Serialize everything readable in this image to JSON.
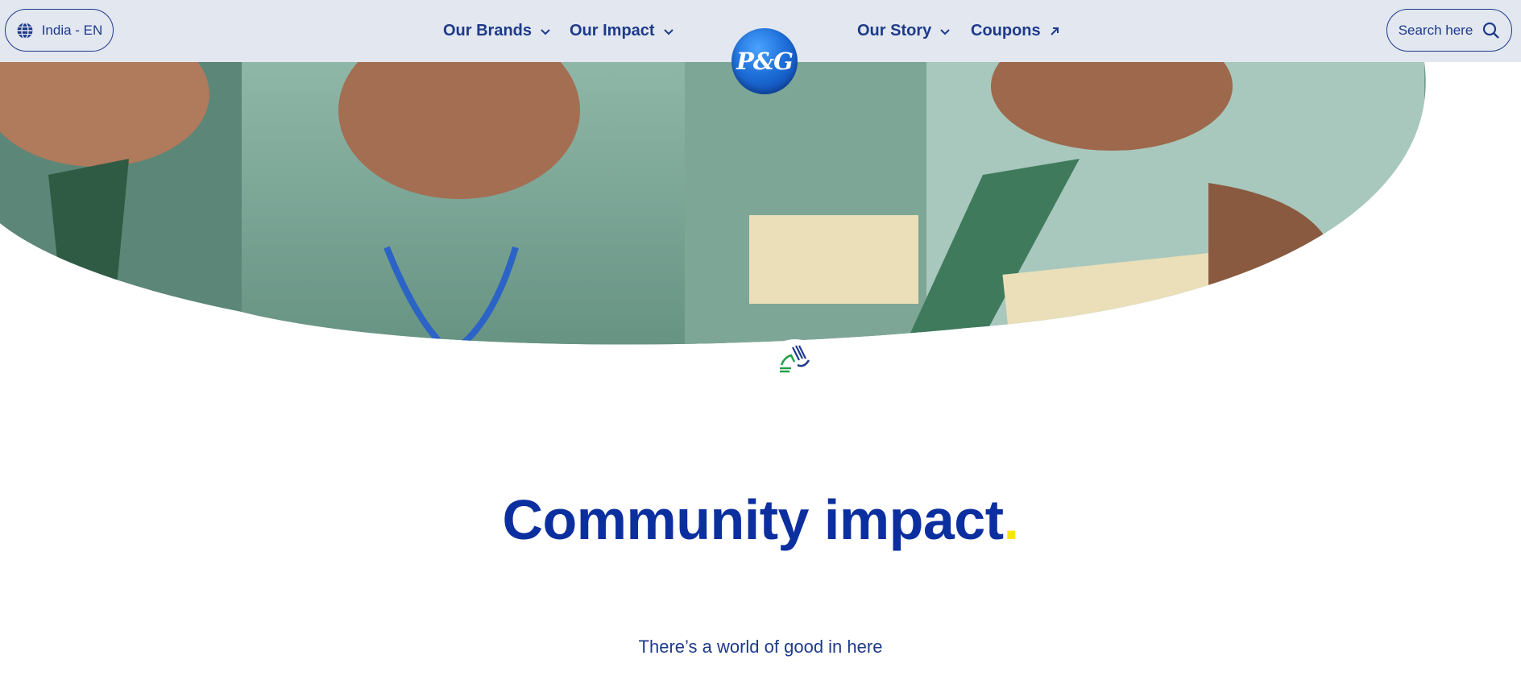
{
  "header": {
    "locale": {
      "label": "India - EN",
      "icon": "globe-icon"
    },
    "nav": [
      {
        "label": "Our Brands",
        "icon": "chevron-down-icon"
      },
      {
        "label": "Our Impact",
        "icon": "chevron-down-icon"
      },
      {
        "label": "Our Story",
        "icon": "chevron-down-icon"
      },
      {
        "label": "Coupons",
        "icon": "arrow-up-right-icon"
      }
    ],
    "logo": "P&G",
    "search": {
      "label": "Search here",
      "icon": "search-icon"
    }
  },
  "hero": {
    "badge_icon": "community-hands-icon"
  },
  "content": {
    "title": "Community impact",
    "title_dot": ".",
    "subtitle": "There’s a world of good in here"
  },
  "colors": {
    "header_bg": "#e2e7f0",
    "primary": "#1e3a8a",
    "title": "#0c2fa0",
    "accent_dot": "#f5e600"
  }
}
